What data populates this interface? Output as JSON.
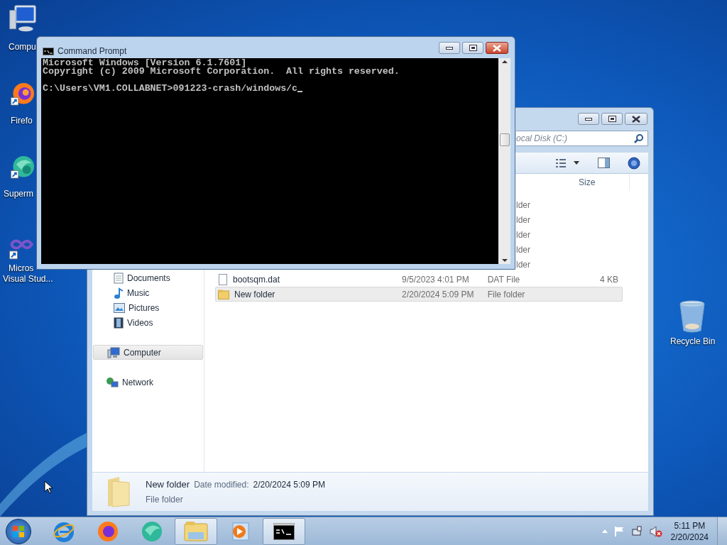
{
  "desktop_icons": [
    {
      "kind": "computer",
      "label": "Compu"
    },
    {
      "kind": "firefox",
      "label": "Firefo"
    },
    {
      "kind": "supermium",
      "label": "Superm"
    },
    {
      "kind": "visual-studio",
      "label": "Micros",
      "label_line_2": "Visual Stud..."
    },
    {
      "kind": "recycle-bin",
      "label": "Recycle Bin"
    }
  ],
  "explorer": {
    "address": "ocal Disk (C:)",
    "columns": [
      "Size"
    ],
    "nav_items": [
      {
        "kind": "documents",
        "label": "Documents",
        "selected": false
      },
      {
        "kind": "music",
        "label": "Music",
        "selected": false
      },
      {
        "kind": "pictures",
        "label": "Pictures",
        "selected": false
      },
      {
        "kind": "videos",
        "label": "Videos",
        "selected": false
      },
      {
        "kind": "computer",
        "label": "Computer",
        "selected": true
      },
      {
        "kind": "network",
        "label": "Network",
        "selected": false
      }
    ],
    "cut_rows": [
      {
        "type": "lder"
      },
      {
        "type": "lder"
      },
      {
        "type": "lder"
      },
      {
        "type": "lder"
      },
      {
        "type": "lder"
      }
    ],
    "rows": [
      {
        "kind": "file",
        "name": "bootsqm.dat",
        "date": "9/5/2023 4:01 PM",
        "type": "DAT File",
        "size": "4 KB",
        "selected": false
      },
      {
        "kind": "folder",
        "name": "New folder",
        "date": "2/20/2024 5:09 PM",
        "type": "File folder",
        "selected": true
      }
    ],
    "details": {
      "name": "New folder",
      "date_label": "Date modified:",
      "date": "2/20/2024 5:09 PM",
      "type": "File folder"
    }
  },
  "command_prompt": {
    "title": "Command Prompt",
    "output": [
      "Microsoft Windows [Version 6.1.7601]",
      "Copyright (c) 2009 Microsoft Corporation.  All rights reserved."
    ],
    "input": "C:\\Users\\VM1.COLLABNET>091223-crash/windows/c"
  },
  "taskbar": {
    "items": [
      {
        "kind": "ie",
        "active": false
      },
      {
        "kind": "firefox",
        "active": false
      },
      {
        "kind": "supermium",
        "active": false
      },
      {
        "kind": "explorer",
        "active": true
      },
      {
        "kind": "media-player",
        "active": false
      },
      {
        "kind": "cmd",
        "active": true
      }
    ],
    "time": "5:11 PM",
    "date": "2/20/2024"
  }
}
